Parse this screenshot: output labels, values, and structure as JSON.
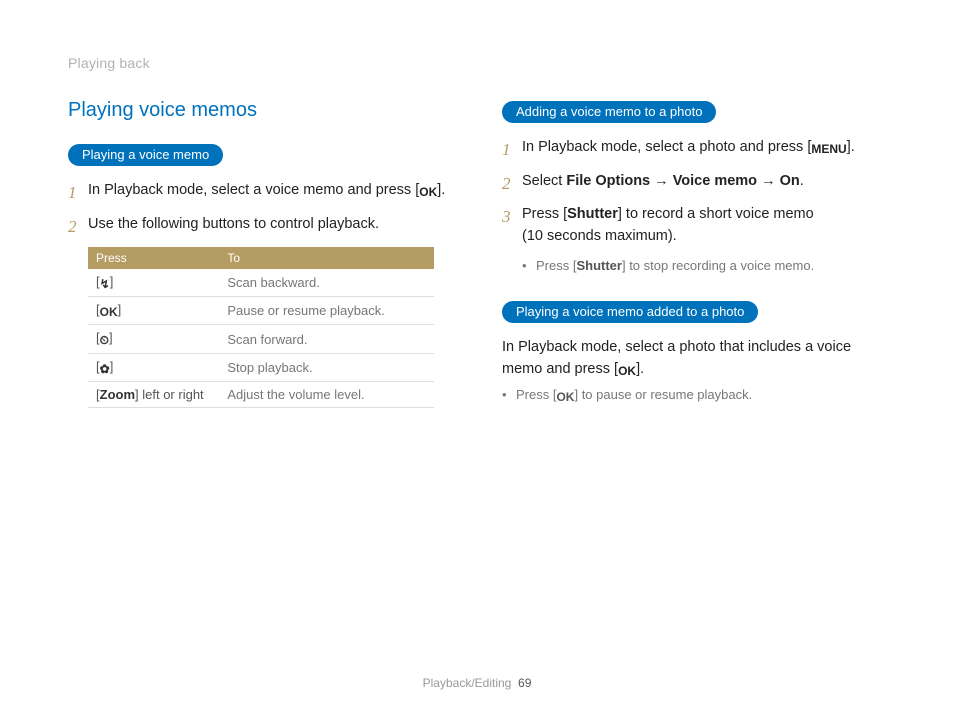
{
  "breadcrumb": "Playing back",
  "sectionTitle": "Playing voice memos",
  "left": {
    "pill": "Playing a voice memo",
    "step1_a": "In Playback mode, select a voice memo and press [",
    "step1_icon": "OK",
    "step1_b": "].",
    "step2": "Use the following buttons to control playback.",
    "table": {
      "h1": "Press",
      "h2": "To",
      "rows": [
        {
          "icon": "↯",
          "suffix": "",
          "action": "Scan backward."
        },
        {
          "icon": "OK",
          "suffix": "",
          "action": "Pause or resume playback."
        },
        {
          "icon": "⏲",
          "suffix": "",
          "action": "Scan forward."
        },
        {
          "icon": "✿",
          "suffix": "",
          "action": "Stop playback."
        },
        {
          "icon": "Zoom",
          "suffix": " left or right",
          "action": "Adjust the volume level."
        }
      ]
    }
  },
  "right": {
    "pill1": "Adding a voice memo to a photo",
    "step1_a": "In Playback mode, select a photo and press [",
    "step1_icon": "MENU",
    "step1_b": "].",
    "step2_a": "Select ",
    "step2_b": "File Options",
    "step2_c": " → ",
    "step2_d": "Voice memo",
    "step2_e": " → ",
    "step2_f": "On",
    "step2_g": ".",
    "step3_a": "Press [",
    "step3_b": "Shutter",
    "step3_c": "] to record a short voice memo",
    "step3_d": "(10 seconds maximum).",
    "step3_sub_a": "Press [",
    "step3_sub_b": "Shutter",
    "step3_sub_c": "] to stop recording a voice memo.",
    "pill2": "Playing a voice memo added to a photo",
    "body_a": "In Playback mode, select a photo that includes a voice memo and press [",
    "body_icon": "OK",
    "body_b": "].",
    "body_sub_a": "Press [",
    "body_sub_icon": "OK",
    "body_sub_b": "] to pause or resume playback."
  },
  "footer": {
    "section": "Playback/Editing",
    "page": "69"
  }
}
